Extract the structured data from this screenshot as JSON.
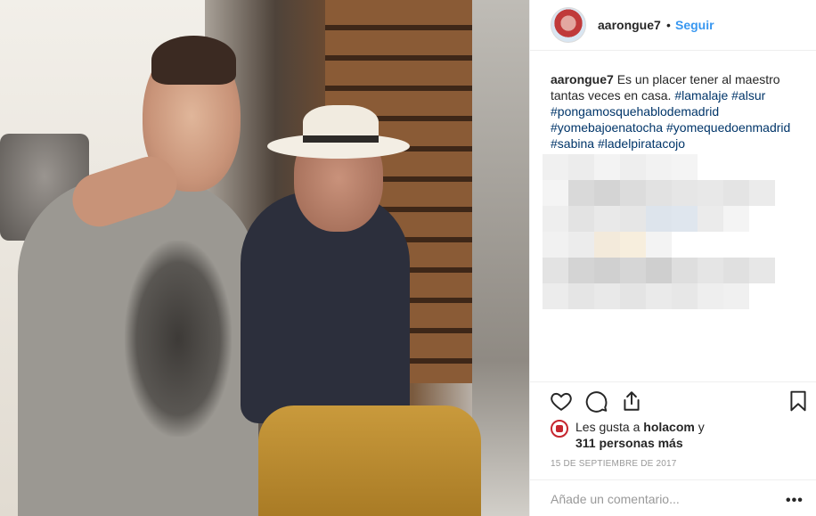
{
  "post": {
    "username": "aarongue7",
    "follow_label": "Seguir",
    "separator": "•"
  },
  "caption": {
    "username": "aarongue7",
    "text_1": "Es un placer tener al maestro tantas veces en casa.",
    "hashtags": [
      "#lamalaje",
      "#alsur",
      "#pongamosquehablodemadrid",
      "#yomebajoenatocha",
      "#yomequedoenmadrid",
      "#sabina",
      "#ladelpiratacojo"
    ]
  },
  "likes": {
    "prefix": "Les gusta a",
    "first_user": "holacom",
    "conjunction": "y",
    "others": "311 personas más"
  },
  "date": "15 de septiembre de 2017",
  "comment": {
    "placeholder": "Añade un comentario...",
    "more_label": "•••"
  },
  "icons": {
    "like": "heart-icon",
    "comment": "comment-bubble-icon",
    "share": "share-icon",
    "save": "bookmark-icon",
    "more": "more-options-icon"
  },
  "colors": {
    "link": "#3897f0",
    "hashtag": "#003569",
    "text": "#262626",
    "muted": "#999999"
  }
}
